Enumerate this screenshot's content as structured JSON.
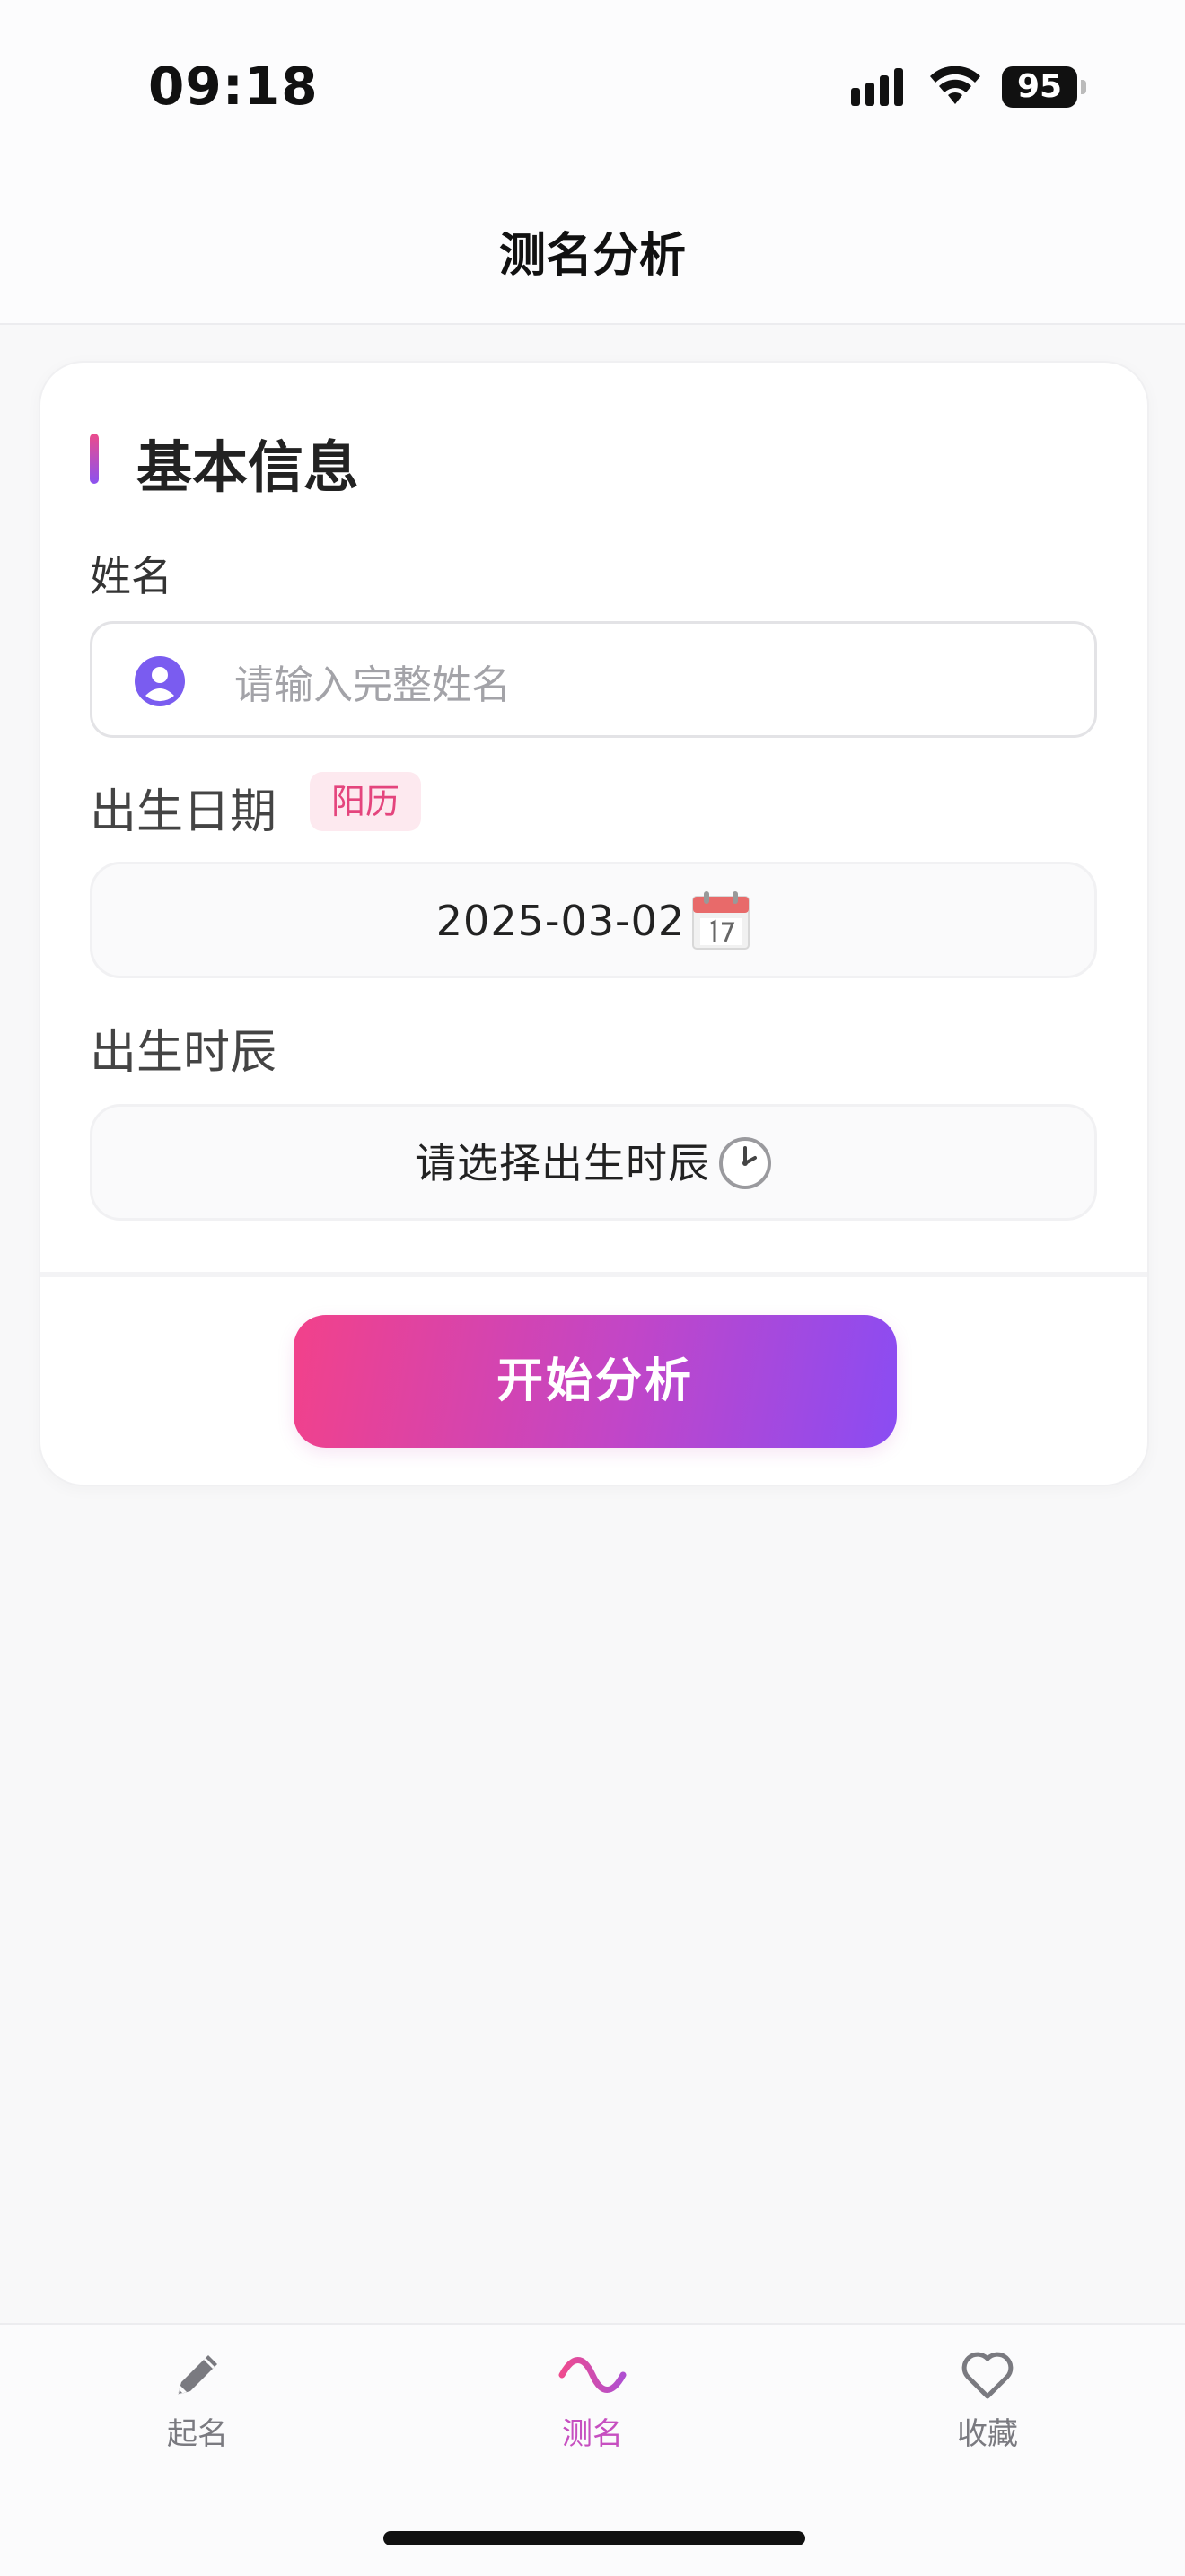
{
  "status_bar": {
    "time": "09:18",
    "battery": "95"
  },
  "header": {
    "title": "测名分析"
  },
  "basic_info": {
    "title": "基本信息",
    "name_label": "姓名",
    "name_placeholder": "请输入完整姓名",
    "birth_date_label": "出生日期",
    "calendar_type": "阳历",
    "birth_date_value": "2025-03-02",
    "birth_time_label": "出生时辰",
    "birth_time_value": "请选择出生时辰",
    "calendar_icon": "calendar-icon",
    "clock_icon": "clock-icon"
  },
  "actions": {
    "start_label": "开始分析"
  },
  "tabbar": {
    "items": [
      {
        "label": "起名",
        "icon": "pencil-icon",
        "active": false
      },
      {
        "label": "测名",
        "icon": "wave-icon",
        "active": true
      },
      {
        "label": "收藏",
        "icon": "heart-icon",
        "active": false
      }
    ]
  },
  "colors": {
    "accent_pink": "#f2418a",
    "accent_purple": "#8a4cf3",
    "badge_text": "#e4457d"
  }
}
